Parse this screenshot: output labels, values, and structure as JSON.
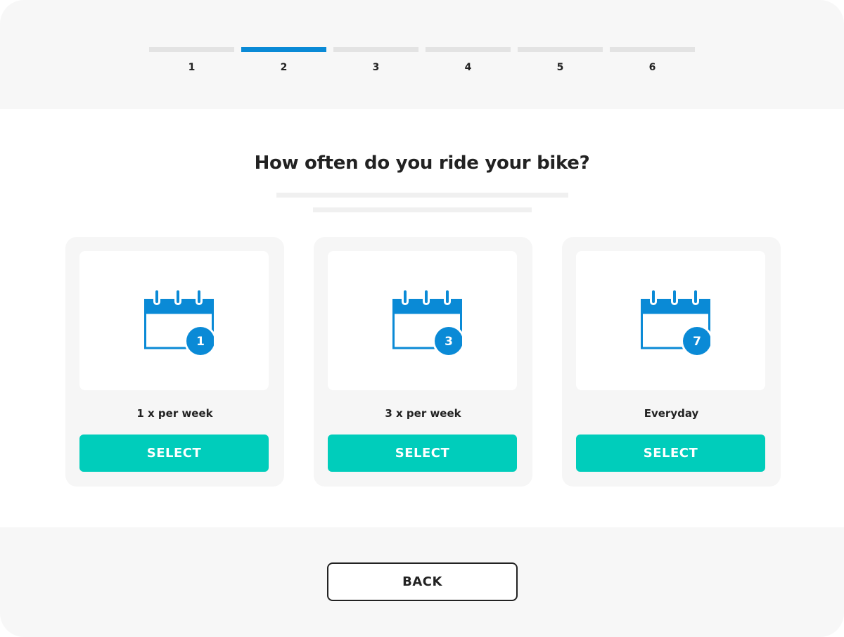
{
  "colors": {
    "accent": "#0a8ad6",
    "select_button": "#00cdbb",
    "header_bg": "#f7f7f7",
    "card_bg": "#f6f6f6"
  },
  "stepper": {
    "current_step": 2,
    "steps": [
      {
        "label": "1"
      },
      {
        "label": "2"
      },
      {
        "label": "3"
      },
      {
        "label": "4"
      },
      {
        "label": "5"
      },
      {
        "label": "6"
      }
    ]
  },
  "question": {
    "title": "How often do you ride your bike?"
  },
  "options": [
    {
      "icon": "calendar-icon",
      "badge": "1",
      "label": "1 x per week",
      "button": "SELECT"
    },
    {
      "icon": "calendar-icon",
      "badge": "3",
      "label": "3 x per week",
      "button": "SELECT"
    },
    {
      "icon": "calendar-icon",
      "badge": "7",
      "label": "Everyday",
      "button": "SELECT"
    }
  ],
  "footer": {
    "back_label": "BACK"
  }
}
